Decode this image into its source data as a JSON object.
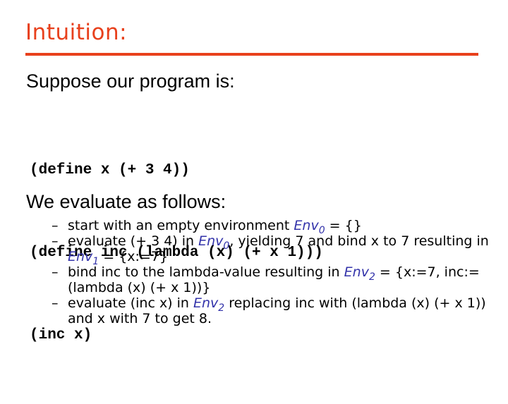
{
  "slide": {
    "title": "Intuition:",
    "accent_color": "#E8401C",
    "env_color": "#3333AA",
    "heading_program": "Suppose our program is:",
    "code_lines": [
      "(define x (+ 3 4))",
      "(define inc (lambda (x) (+ x 1)))",
      "(inc x)"
    ],
    "heading_evaluate": "We evaluate as follows:",
    "bullet_marker": "–",
    "env_label": "Env",
    "bullets": [
      {
        "parts": {
          "a": "start with an empty environment ",
          "env_sub": "0",
          "b": " = {}"
        }
      },
      {
        "parts": {
          "a": "evaluate (+ 3 4) in ",
          "env_sub": "0",
          "b": ", yielding 7 and bind x to 7 resulting in ",
          "env2_sub": "1",
          "c": " = {x:=7}"
        }
      },
      {
        "parts": {
          "a": "bind inc to the lambda-value resulting in ",
          "env_sub": "2",
          "b": " = {x:=7, inc:=(lambda (x) (+ x 1))}"
        }
      },
      {
        "parts": {
          "a": "evaluate (inc x) in ",
          "env_sub": "2",
          "b": " replacing inc with (lambda (x) (+ x 1)) and x with 7 to get 8."
        }
      }
    ]
  }
}
